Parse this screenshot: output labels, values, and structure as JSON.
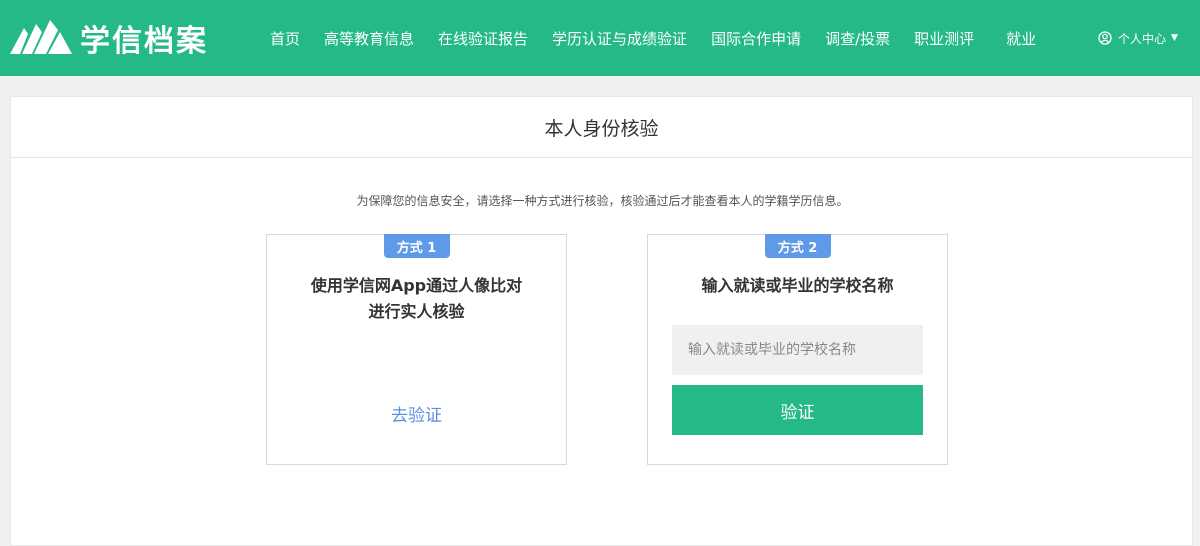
{
  "header": {
    "logo_text": "学信档案",
    "nav": [
      "首页",
      "高等教育信息",
      "在线验证报告",
      "学历认证与成绩验证",
      "国际合作申请",
      "调查/投票",
      "职业测评",
      "就业"
    ],
    "user_menu": "个人中心",
    "brand_color": "#24b985"
  },
  "main": {
    "title": "本人身份核验",
    "notice": "为保障您的信息安全，请选择一种方式进行核验，核验通过后才能查看本人的学籍学历信息。",
    "method1": {
      "badge": "方式 1",
      "title_line1": "使用学信网App通过人像比对",
      "title_line2": "进行实人核验",
      "link": "去验证"
    },
    "method2": {
      "badge": "方式 2",
      "title": "输入就读或毕业的学校名称",
      "input_placeholder": "输入就读或毕业的学校名称",
      "input_value": "",
      "button": "验证"
    }
  }
}
